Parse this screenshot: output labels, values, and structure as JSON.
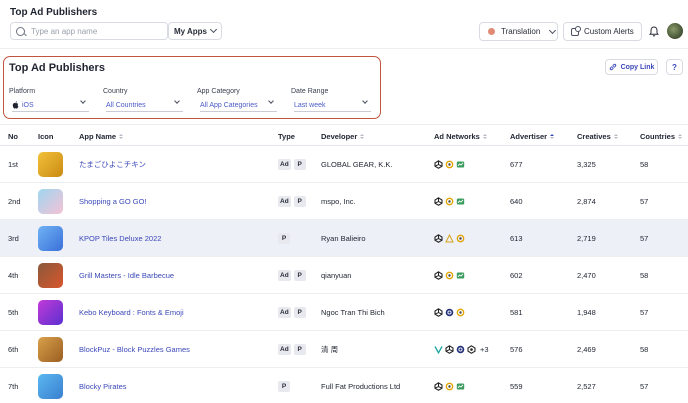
{
  "page_title": "Top Ad Publishers",
  "search": {
    "placeholder": "Type an app name"
  },
  "my_apps_label": "My Apps",
  "translation_label": "Translation",
  "custom_alerts_label": "Custom Alerts",
  "section_title": "Top Ad Publishers",
  "copy_link_label": "Copy Link",
  "help_label": "?",
  "filters": [
    {
      "label": "Platform",
      "value": "iOS"
    },
    {
      "label": "Country",
      "value": "All Countries"
    },
    {
      "label": "App Category",
      "value": "All App Categories"
    },
    {
      "label": "Date Range",
      "value": "Last week"
    }
  ],
  "columns": [
    "No",
    "Icon",
    "App Name",
    "Type",
    "Developer",
    "Ad Networks",
    "Advertiser",
    "Creatives",
    "Countries"
  ],
  "rows": [
    {
      "no": "1st",
      "app_name": "たまごひよこチキン",
      "developer": "GLOBAL GEAR, K.K.",
      "advertiser": "677",
      "creatives": "3,325",
      "countries": "58",
      "more": ""
    },
    {
      "no": "2nd",
      "app_name": "Shopping a GO GO!",
      "developer": "mspo, Inc.",
      "advertiser": "640",
      "creatives": "2,874",
      "countries": "57",
      "more": ""
    },
    {
      "no": "3rd",
      "app_name": "KPOP Tiles Deluxe 2022",
      "developer": "Ryan Balieiro",
      "advertiser": "613",
      "creatives": "2,719",
      "countries": "57",
      "more": ""
    },
    {
      "no": "4th",
      "app_name": "Grill Masters - Idle Barbecue",
      "developer": "qianyuan",
      "advertiser": "602",
      "creatives": "2,470",
      "countries": "58",
      "more": ""
    },
    {
      "no": "5th",
      "app_name": "Kebo Keyboard : Fonts & Emoji",
      "developer": "Ngoc Tran Thi Bich",
      "advertiser": "581",
      "creatives": "1,948",
      "countries": "57",
      "more": ""
    },
    {
      "no": "6th",
      "app_name": "BlockPuz - Block Puzzles Games",
      "developer": "清 周",
      "advertiser": "576",
      "creatives": "2,469",
      "countries": "58",
      "more": "+3"
    },
    {
      "no": "7th",
      "app_name": "Blocky Pirates",
      "developer": "Full Fat Productions Ltd",
      "advertiser": "559",
      "creatives": "2,527",
      "countries": "57",
      "more": ""
    }
  ],
  "type_badges": {
    "ad": "Ad",
    "p": "P"
  },
  "colors": {
    "accent": "#3b48b8",
    "highlight_border": "#c0553f",
    "alt_row": "#eef0f8"
  }
}
